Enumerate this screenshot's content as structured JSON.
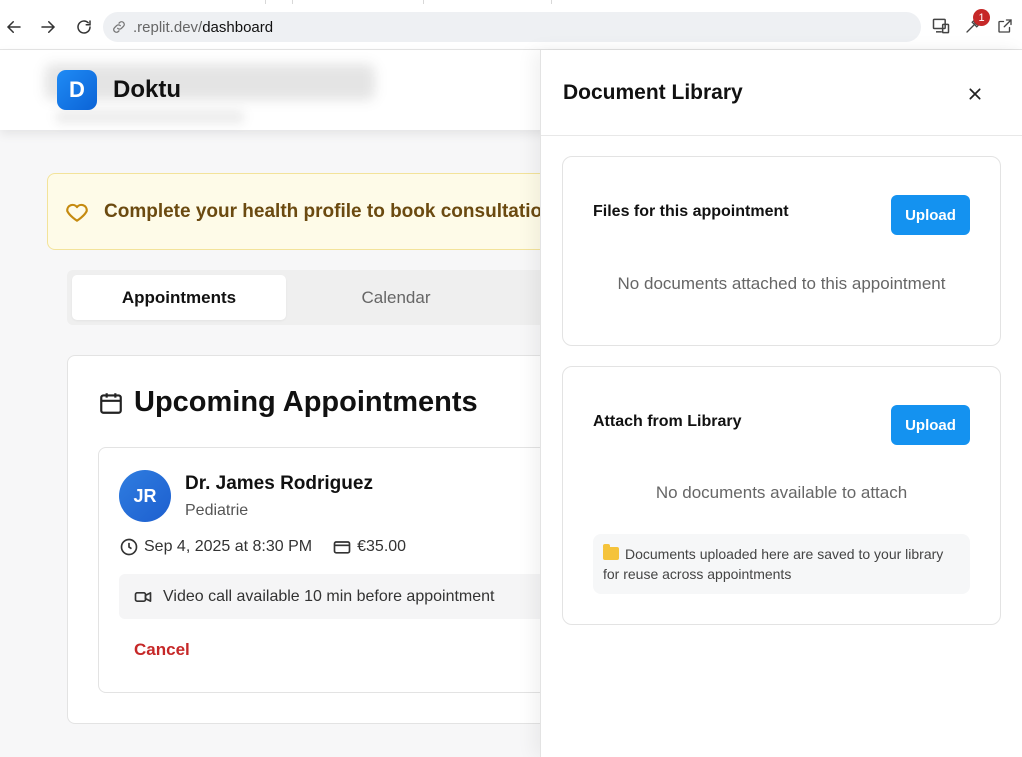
{
  "browser": {
    "url_domain": ".replit.dev/",
    "url_path": "dashboard",
    "extension_badge": "1"
  },
  "app": {
    "logo_letter": "D",
    "brand_name": "Doktu",
    "alert_text": "Complete your health profile to book consultatio",
    "tabs": [
      {
        "label": "Appointments",
        "active": true
      },
      {
        "label": "Calendar",
        "active": false
      }
    ],
    "upcoming": {
      "title": "Upcoming Appointments",
      "appointment": {
        "initials": "JR",
        "doctor_name": "Dr. James Rodriguez",
        "specialty": "Pediatrie",
        "datetime": "Sep 4, 2025 at 8:30 PM",
        "price": "€35.00",
        "video_note": "Video call available 10 min before appointment",
        "cancel_label": "Cancel"
      }
    }
  },
  "panel": {
    "title": "Document Library",
    "sections": [
      {
        "title": "Files for this appointment",
        "upload_label": "Upload",
        "empty_text": "No documents attached to this appointment"
      },
      {
        "title": "Attach from Library",
        "upload_label": "Upload",
        "empty_text": "No documents available to attach",
        "note": "Documents uploaded here are saved to your library for reuse across appointments"
      }
    ]
  },
  "colors": {
    "primary": "#1492f0",
    "danger": "#c62828",
    "alert_bg": "#fefbe8",
    "alert_text": "#6b4a10"
  }
}
